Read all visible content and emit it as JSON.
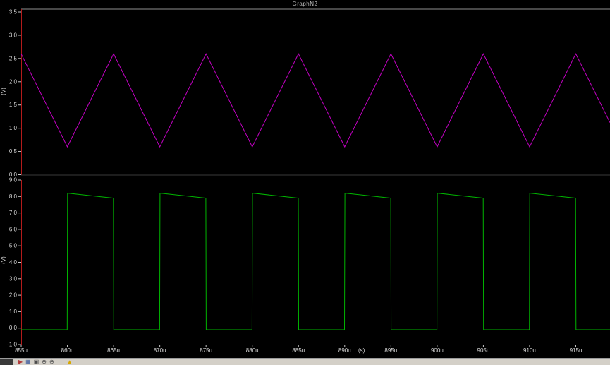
{
  "title": "GraphN2",
  "colors": {
    "background": "#000000",
    "axis": "#b31b1b",
    "frame": "#8f8f8f",
    "tick": "#c8c8c8"
  },
  "chart_data": [
    {
      "type": "line",
      "name": "triangle-wave-plot",
      "color": "#c400c4",
      "ylabel": "(V)",
      "ylim": [
        0,
        3.5
      ],
      "yticks": [
        3.5,
        3.0,
        2.5,
        2.0,
        1.5,
        1.0,
        0.5,
        0.0
      ],
      "ytick_labels": [
        "3.5",
        "3.0",
        "2.5",
        "2.0",
        "1.5",
        "1.0",
        "0.5",
        "0.0"
      ],
      "xlim_us": [
        855,
        918.7
      ],
      "points_us_v": [
        [
          855,
          2.6
        ],
        [
          860,
          0.6
        ],
        [
          865,
          2.6
        ],
        [
          870,
          0.6
        ],
        [
          875,
          2.6
        ],
        [
          880,
          0.6
        ],
        [
          885,
          2.6
        ],
        [
          890,
          0.6
        ],
        [
          895,
          2.6
        ],
        [
          900,
          0.6
        ],
        [
          905,
          2.6
        ],
        [
          910,
          0.6
        ],
        [
          915,
          2.6
        ],
        [
          918.7,
          1.12
        ]
      ]
    },
    {
      "type": "line",
      "name": "square-wave-plot",
      "color": "#00b400",
      "ylabel": "(V)",
      "xlabel": "(s)",
      "ylim": [
        -1,
        9
      ],
      "yticks": [
        9,
        8,
        7,
        6,
        5,
        4,
        3,
        2,
        1,
        0,
        -1
      ],
      "ytick_labels": [
        "9.0",
        "8.0",
        "7.0",
        "6.0",
        "5.0",
        "4.0",
        "3.0",
        "2.0",
        "1.0",
        "0.0",
        "-1.0"
      ],
      "xlim_us": [
        855,
        918.7
      ],
      "xticks_us": [
        855,
        860,
        865,
        870,
        875,
        880,
        885,
        890,
        895,
        900,
        905,
        910,
        915
      ],
      "xtick_labels": [
        "855u",
        "860u",
        "865u",
        "870u",
        "875u",
        "880u",
        "885u",
        "890u",
        "895u",
        "900u",
        "905u",
        "910u",
        "915u"
      ],
      "points_us_v": [
        [
          855,
          -0.1
        ],
        [
          859.98,
          -0.1
        ],
        [
          860.02,
          8.2
        ],
        [
          864.98,
          7.9
        ],
        [
          865.02,
          -0.1
        ],
        [
          869.98,
          -0.1
        ],
        [
          870.02,
          8.2
        ],
        [
          874.98,
          7.9
        ],
        [
          875.02,
          -0.1
        ],
        [
          879.98,
          -0.1
        ],
        [
          880.02,
          8.2
        ],
        [
          884.98,
          7.9
        ],
        [
          885.02,
          -0.1
        ],
        [
          889.98,
          -0.1
        ],
        [
          890.02,
          8.2
        ],
        [
          894.98,
          7.9
        ],
        [
          895.02,
          -0.1
        ],
        [
          899.98,
          -0.1
        ],
        [
          900.02,
          8.2
        ],
        [
          904.98,
          7.9
        ],
        [
          905.02,
          -0.1
        ],
        [
          909.98,
          -0.1
        ],
        [
          910.02,
          8.2
        ],
        [
          914.98,
          7.9
        ],
        [
          915.02,
          -0.1
        ],
        [
          918.7,
          -0.1
        ]
      ]
    }
  ],
  "taskbar": {
    "items": [
      {
        "name": "taskbar-left-button",
        "block": true,
        "color": "#3a3a3a"
      },
      {
        "name": "run-simulation-icon",
        "glyph": "▶",
        "color": "#b23a3a"
      },
      {
        "name": "graph-mode-icon",
        "glyph": "▦",
        "color": "#35559c"
      },
      {
        "name": "save-icon",
        "glyph": "▣",
        "color": "#4c4c4c"
      },
      {
        "name": "zoom-in-icon",
        "glyph": "⊕",
        "color": "#4c4c4c"
      },
      {
        "name": "zoom-out-icon",
        "glyph": "⊖",
        "color": "#4c4c4c"
      },
      {
        "name": "warning-icon",
        "glyph": "▲",
        "color": "#d8a800"
      }
    ]
  }
}
